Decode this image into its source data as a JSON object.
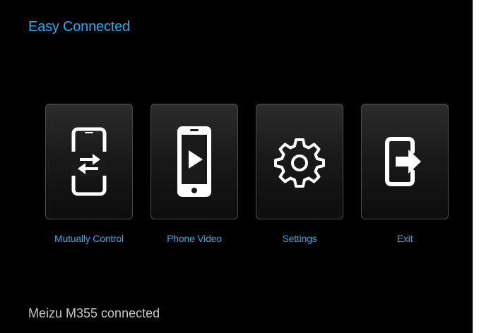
{
  "app": {
    "title": "Easy Connected"
  },
  "menu": {
    "items": [
      {
        "label": "Mutually Control",
        "icon": "phone-transfer-icon"
      },
      {
        "label": "Phone Video",
        "icon": "phone-play-icon"
      },
      {
        "label": "Settings",
        "icon": "gear-icon"
      },
      {
        "label": "Exit",
        "icon": "exit-icon"
      }
    ]
  },
  "status": {
    "text": "Meizu M355 connected"
  },
  "colors": {
    "accent": "#33a6e8",
    "background": "#000000",
    "tile_border": "#4a4a4a",
    "status_text": "#c8c8c8"
  }
}
